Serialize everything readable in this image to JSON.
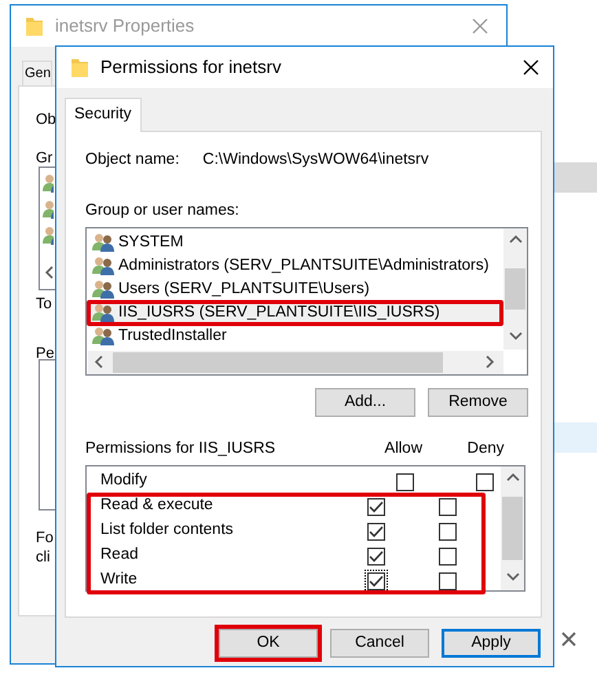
{
  "back_window": {
    "title": "inetsrv Properties",
    "tab": "Gen",
    "labels": [
      "Ob",
      "Gr",
      "To",
      "Pe"
    ],
    "footer_lines": [
      "Fo",
      "cli"
    ]
  },
  "dialog": {
    "title": "Permissions for inetsrv",
    "tabs": [
      {
        "label": "Security",
        "selected": true
      }
    ],
    "object_name_label": "Object name:",
    "object_name": "C:\\Windows\\SysWOW64\\inetsrv",
    "group_label": "Group or user names:",
    "users": [
      {
        "name": "SYSTEM",
        "selected": false,
        "highlighted": false
      },
      {
        "name": "Administrators (SERV_PLANTSUITE\\Administrators)",
        "selected": false,
        "highlighted": false
      },
      {
        "name": "Users (SERV_PLANTSUITE\\Users)",
        "selected": false,
        "highlighted": false
      },
      {
        "name": "IIS_IUSRS (SERV_PLANTSUITE\\IIS_IUSRS)",
        "selected": true,
        "highlighted": true
      },
      {
        "name": "TrustedInstaller",
        "selected": false,
        "highlighted": false
      }
    ],
    "user_buttons": [
      "Add...",
      "Remove"
    ],
    "permissions_label": "Permissions for IIS_IUSRS",
    "columns": [
      "Allow",
      "Deny"
    ],
    "permissions": [
      {
        "name": "Modify",
        "allow": false,
        "deny": false,
        "focused": false,
        "highlighted": false
      },
      {
        "name": "Read & execute",
        "allow": true,
        "deny": false,
        "focused": false,
        "highlighted": true
      },
      {
        "name": "List folder contents",
        "allow": true,
        "deny": false,
        "focused": false,
        "highlighted": true
      },
      {
        "name": "Read",
        "allow": true,
        "deny": false,
        "focused": false,
        "highlighted": true
      },
      {
        "name": "Write",
        "allow": true,
        "deny": false,
        "focused": true,
        "highlighted": true
      }
    ],
    "buttons": [
      {
        "label": "OK",
        "default": false,
        "highlighted": true
      },
      {
        "label": "Cancel",
        "default": false,
        "highlighted": false
      },
      {
        "label": "Apply",
        "default": true,
        "highlighted": false
      }
    ]
  }
}
